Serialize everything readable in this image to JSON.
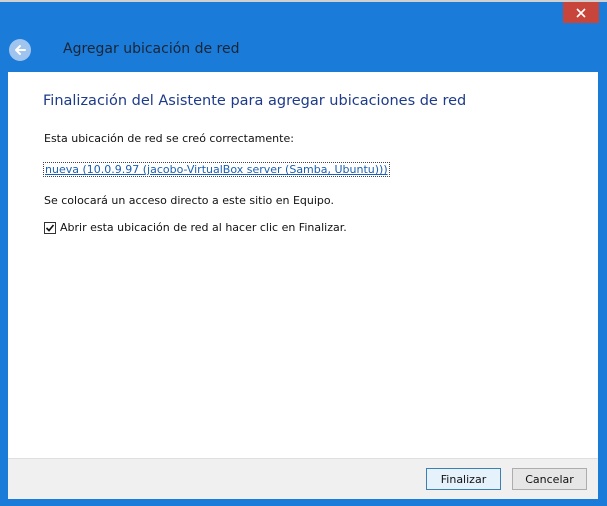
{
  "window": {
    "header_title": "Agregar ubicación de red"
  },
  "content": {
    "wizard_title": "Finalización del Asistente para agregar ubicaciones de red",
    "created_text": "Esta ubicación de red se creó correctamente:",
    "location_link": "nueva (10.0.9.97 (jacobo-VirtualBox server (Samba, Ubuntu)))",
    "shortcut_text": "Se colocará un acceso directo a este sitio en Equipo.",
    "open_checkbox": {
      "label": "Abrir esta ubicación de red al hacer clic en Finalizar.",
      "checked": true
    }
  },
  "footer": {
    "finish_label": "Finalizar",
    "cancel_label": "Cancelar"
  },
  "colors": {
    "title_bar": "#1b7bd9",
    "close_button": "#c7453a",
    "wizard_title": "#1e3b8a",
    "link": "#1a5fb4"
  },
  "icons": {
    "close": "close-icon",
    "back": "back-arrow-icon",
    "check": "checkmark-icon"
  }
}
